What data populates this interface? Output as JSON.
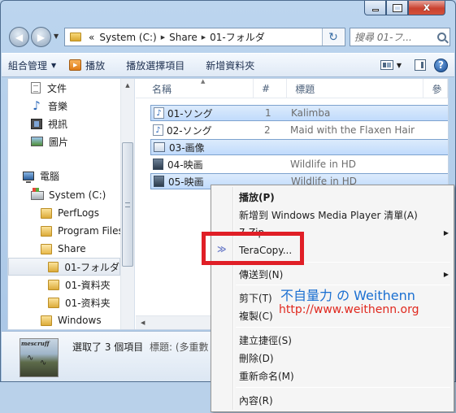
{
  "window": {
    "close_glyph": "x"
  },
  "nav": {
    "back_glyph": "◀",
    "forward_glyph": "▶",
    "breadcrumb_prefix": "«",
    "path": [
      "System (C:)",
      "Share",
      "01-フォルダ"
    ],
    "search_placeholder": "搜尋 01-フ..."
  },
  "toolbar": {
    "organize": "組合管理",
    "play": "播放",
    "play_selection": "播放選擇項目",
    "new_folder": "新增資料夾",
    "help": "?"
  },
  "nav_pane": {
    "items": [
      {
        "label": "文件",
        "icon": "document-icon"
      },
      {
        "label": "音樂",
        "icon": "music-icon"
      },
      {
        "label": "視訊",
        "icon": "video-icon"
      },
      {
        "label": "圖片",
        "icon": "picture-icon"
      },
      {
        "label": "電腦",
        "icon": "computer-icon"
      },
      {
        "label": "System (C:)",
        "icon": "drive-icon"
      },
      {
        "label": "PerfLogs",
        "icon": "folder-icon"
      },
      {
        "label": "Program Files",
        "icon": "folder-icon"
      },
      {
        "label": "Share",
        "icon": "folder-icon"
      },
      {
        "label": "01-フォルダ",
        "icon": "folder-icon",
        "selected": true
      },
      {
        "label": "01-資料夾",
        "icon": "folder-icon"
      },
      {
        "label": "01-资料夹",
        "icon": "folder-icon"
      },
      {
        "label": "Windows",
        "icon": "folder-icon"
      }
    ]
  },
  "file_list": {
    "columns": [
      "名稱",
      "#",
      "標題",
      "參"
    ],
    "rows": [
      {
        "name": "01-ソング",
        "num": "1",
        "title": "Kalimba",
        "type": "music",
        "selected": true
      },
      {
        "name": "02-ソング",
        "num": "2",
        "title": "Maid with the Flaxen Hair",
        "type": "music",
        "selected": false
      },
      {
        "name": "03-画像",
        "num": "",
        "title": "",
        "type": "folder",
        "selected": true
      },
      {
        "name": "04-映画",
        "num": "",
        "title": "Wildlife in HD",
        "type": "video",
        "selected": false
      },
      {
        "name": "05-映画",
        "num": "",
        "title": "Wildlife in HD",
        "type": "video",
        "selected": true
      }
    ]
  },
  "details": {
    "thumb_label": "mescruff",
    "summary": "選取了 3 個項目",
    "field": "標題: (多重數"
  },
  "context_menu": {
    "items": [
      {
        "label": "播放(P)"
      },
      {
        "label": "新增到 Windows Media Player 清單(A)"
      },
      {
        "label": "7-Zip",
        "submenu": true
      },
      {
        "label": "TeraCopy...",
        "highlighted": true
      },
      {
        "label": "傳送到(N)",
        "submenu": true
      },
      {
        "label": "剪下(T)"
      },
      {
        "label": "複製(C)"
      },
      {
        "label": "建立捷徑(S)"
      },
      {
        "label": "刪除(D)"
      },
      {
        "label": "重新命名(M)"
      },
      {
        "label": "內容(R)"
      }
    ],
    "submenu_glyph": "▶",
    "teracopy_icon_glyph": "≫"
  },
  "watermark": {
    "title": "不自量力 の Weithenn",
    "url": "http://www.weithenn.org"
  },
  "colors": {
    "highlight_border": "#e01e26",
    "watermark_title": "#1a6fd1",
    "watermark_url": "#e0281e",
    "selection": "#c1dbfc"
  }
}
